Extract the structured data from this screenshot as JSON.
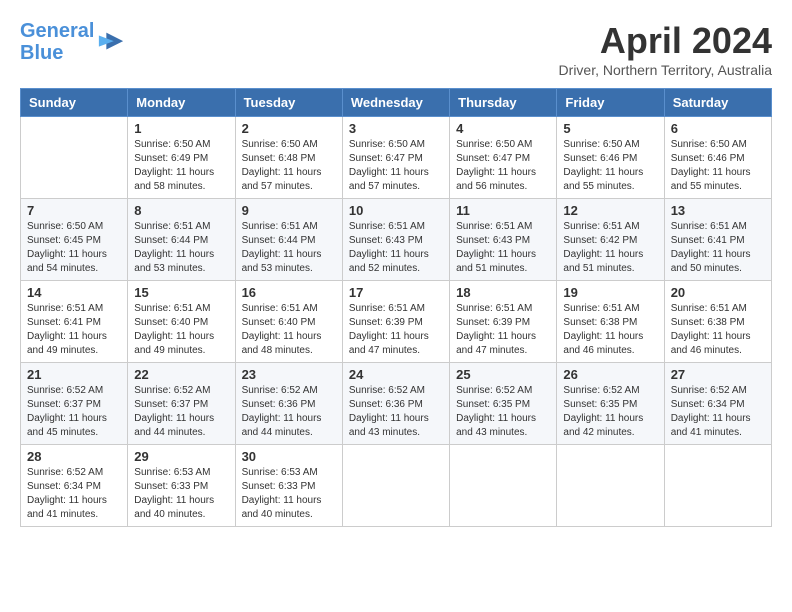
{
  "logo": {
    "line1": "General",
    "line2": "Blue"
  },
  "title": "April 2024",
  "location": "Driver, Northern Territory, Australia",
  "days_of_week": [
    "Sunday",
    "Monday",
    "Tuesday",
    "Wednesday",
    "Thursday",
    "Friday",
    "Saturday"
  ],
  "weeks": [
    [
      {
        "day": "",
        "sunrise": "",
        "sunset": "",
        "daylight": ""
      },
      {
        "day": "1",
        "sunrise": "Sunrise: 6:50 AM",
        "sunset": "Sunset: 6:49 PM",
        "daylight": "Daylight: 11 hours and 58 minutes."
      },
      {
        "day": "2",
        "sunrise": "Sunrise: 6:50 AM",
        "sunset": "Sunset: 6:48 PM",
        "daylight": "Daylight: 11 hours and 57 minutes."
      },
      {
        "day": "3",
        "sunrise": "Sunrise: 6:50 AM",
        "sunset": "Sunset: 6:47 PM",
        "daylight": "Daylight: 11 hours and 57 minutes."
      },
      {
        "day": "4",
        "sunrise": "Sunrise: 6:50 AM",
        "sunset": "Sunset: 6:47 PM",
        "daylight": "Daylight: 11 hours and 56 minutes."
      },
      {
        "day": "5",
        "sunrise": "Sunrise: 6:50 AM",
        "sunset": "Sunset: 6:46 PM",
        "daylight": "Daylight: 11 hours and 55 minutes."
      },
      {
        "day": "6",
        "sunrise": "Sunrise: 6:50 AM",
        "sunset": "Sunset: 6:46 PM",
        "daylight": "Daylight: 11 hours and 55 minutes."
      }
    ],
    [
      {
        "day": "7",
        "sunrise": "Sunrise: 6:50 AM",
        "sunset": "Sunset: 6:45 PM",
        "daylight": "Daylight: 11 hours and 54 minutes."
      },
      {
        "day": "8",
        "sunrise": "Sunrise: 6:51 AM",
        "sunset": "Sunset: 6:44 PM",
        "daylight": "Daylight: 11 hours and 53 minutes."
      },
      {
        "day": "9",
        "sunrise": "Sunrise: 6:51 AM",
        "sunset": "Sunset: 6:44 PM",
        "daylight": "Daylight: 11 hours and 53 minutes."
      },
      {
        "day": "10",
        "sunrise": "Sunrise: 6:51 AM",
        "sunset": "Sunset: 6:43 PM",
        "daylight": "Daylight: 11 hours and 52 minutes."
      },
      {
        "day": "11",
        "sunrise": "Sunrise: 6:51 AM",
        "sunset": "Sunset: 6:43 PM",
        "daylight": "Daylight: 11 hours and 51 minutes."
      },
      {
        "day": "12",
        "sunrise": "Sunrise: 6:51 AM",
        "sunset": "Sunset: 6:42 PM",
        "daylight": "Daylight: 11 hours and 51 minutes."
      },
      {
        "day": "13",
        "sunrise": "Sunrise: 6:51 AM",
        "sunset": "Sunset: 6:41 PM",
        "daylight": "Daylight: 11 hours and 50 minutes."
      }
    ],
    [
      {
        "day": "14",
        "sunrise": "Sunrise: 6:51 AM",
        "sunset": "Sunset: 6:41 PM",
        "daylight": "Daylight: 11 hours and 49 minutes."
      },
      {
        "day": "15",
        "sunrise": "Sunrise: 6:51 AM",
        "sunset": "Sunset: 6:40 PM",
        "daylight": "Daylight: 11 hours and 49 minutes."
      },
      {
        "day": "16",
        "sunrise": "Sunrise: 6:51 AM",
        "sunset": "Sunset: 6:40 PM",
        "daylight": "Daylight: 11 hours and 48 minutes."
      },
      {
        "day": "17",
        "sunrise": "Sunrise: 6:51 AM",
        "sunset": "Sunset: 6:39 PM",
        "daylight": "Daylight: 11 hours and 47 minutes."
      },
      {
        "day": "18",
        "sunrise": "Sunrise: 6:51 AM",
        "sunset": "Sunset: 6:39 PM",
        "daylight": "Daylight: 11 hours and 47 minutes."
      },
      {
        "day": "19",
        "sunrise": "Sunrise: 6:51 AM",
        "sunset": "Sunset: 6:38 PM",
        "daylight": "Daylight: 11 hours and 46 minutes."
      },
      {
        "day": "20",
        "sunrise": "Sunrise: 6:51 AM",
        "sunset": "Sunset: 6:38 PM",
        "daylight": "Daylight: 11 hours and 46 minutes."
      }
    ],
    [
      {
        "day": "21",
        "sunrise": "Sunrise: 6:52 AM",
        "sunset": "Sunset: 6:37 PM",
        "daylight": "Daylight: 11 hours and 45 minutes."
      },
      {
        "day": "22",
        "sunrise": "Sunrise: 6:52 AM",
        "sunset": "Sunset: 6:37 PM",
        "daylight": "Daylight: 11 hours and 44 minutes."
      },
      {
        "day": "23",
        "sunrise": "Sunrise: 6:52 AM",
        "sunset": "Sunset: 6:36 PM",
        "daylight": "Daylight: 11 hours and 44 minutes."
      },
      {
        "day": "24",
        "sunrise": "Sunrise: 6:52 AM",
        "sunset": "Sunset: 6:36 PM",
        "daylight": "Daylight: 11 hours and 43 minutes."
      },
      {
        "day": "25",
        "sunrise": "Sunrise: 6:52 AM",
        "sunset": "Sunset: 6:35 PM",
        "daylight": "Daylight: 11 hours and 43 minutes."
      },
      {
        "day": "26",
        "sunrise": "Sunrise: 6:52 AM",
        "sunset": "Sunset: 6:35 PM",
        "daylight": "Daylight: 11 hours and 42 minutes."
      },
      {
        "day": "27",
        "sunrise": "Sunrise: 6:52 AM",
        "sunset": "Sunset: 6:34 PM",
        "daylight": "Daylight: 11 hours and 41 minutes."
      }
    ],
    [
      {
        "day": "28",
        "sunrise": "Sunrise: 6:52 AM",
        "sunset": "Sunset: 6:34 PM",
        "daylight": "Daylight: 11 hours and 41 minutes."
      },
      {
        "day": "29",
        "sunrise": "Sunrise: 6:53 AM",
        "sunset": "Sunset: 6:33 PM",
        "daylight": "Daylight: 11 hours and 40 minutes."
      },
      {
        "day": "30",
        "sunrise": "Sunrise: 6:53 AM",
        "sunset": "Sunset: 6:33 PM",
        "daylight": "Daylight: 11 hours and 40 minutes."
      },
      {
        "day": "",
        "sunrise": "",
        "sunset": "",
        "daylight": ""
      },
      {
        "day": "",
        "sunrise": "",
        "sunset": "",
        "daylight": ""
      },
      {
        "day": "",
        "sunrise": "",
        "sunset": "",
        "daylight": ""
      },
      {
        "day": "",
        "sunrise": "",
        "sunset": "",
        "daylight": ""
      }
    ]
  ]
}
